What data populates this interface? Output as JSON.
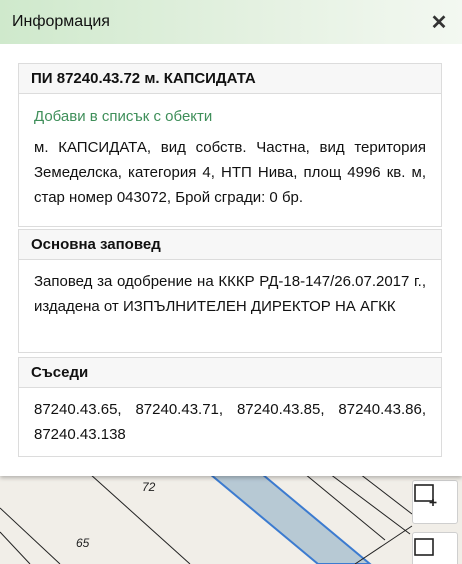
{
  "header": {
    "title": "Информация",
    "close_glyph": "✕"
  },
  "parcel": {
    "title": "ПИ 87240.43.72 м. КАПСИДАТА",
    "add_link": "Добави в списък с обекти",
    "description": "м. КАПСИДАТА, вид собств. Частна, вид територия Земеделска, категория 4, НТП Нива, площ 4996 кв. м, стар номер 043072, Брой сгради: 0 бр."
  },
  "order": {
    "heading": "Основна заповед",
    "text": "Заповед за одобрение на КККР РД-18-147/26.07.2017 г., издадена от ИЗПЪЛНИТЕЛЕН ДИРЕКТОР НА АГКК"
  },
  "neighbors": {
    "heading": "Съседи",
    "text": "87240.43.65, 87240.43.71, 87240.43.85, 87240.43.86, 87240.43.138"
  },
  "map": {
    "labels": [
      "72",
      "65"
    ],
    "colors": {
      "parcel_fill": "#b7c9d4",
      "parcel_stroke": "#3c7bd0",
      "background": "#f1eee8"
    },
    "tools": [
      "select-rectangle-icon",
      "select-rectangle-icon"
    ]
  }
}
